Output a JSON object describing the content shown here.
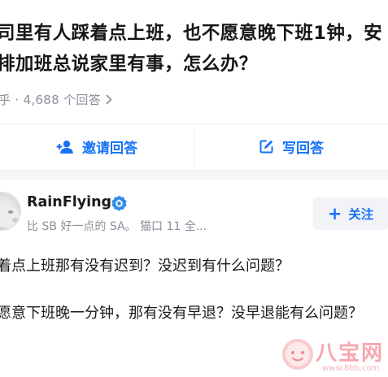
{
  "question": {
    "title": "司里有人踩着点上班，也不愿意晚下班1钟，安排加班总说家里有事，怎么办？",
    "meta": "乎 · 4,688 个回答"
  },
  "actions": {
    "invite_label": "邀请回答",
    "write_label": "写回答"
  },
  "answer": {
    "author_name": "RainFlying",
    "author_bio": "比 SB 好一点的 SA。 猫口 11 全...",
    "follow_label": "关注",
    "paragraphs": [
      "着点上班那有没有迟到？没迟到有什么问题？",
      "愿意下班晚一分钟，那有没有早退？没早退能有么问题？"
    ]
  },
  "watermark": {
    "text": "八宝网",
    "url": "www.8bb.com"
  },
  "colors": {
    "accent": "#1772f6",
    "meta_gray": "#8a8f99",
    "watermark_pink": "#f5a8b0"
  }
}
